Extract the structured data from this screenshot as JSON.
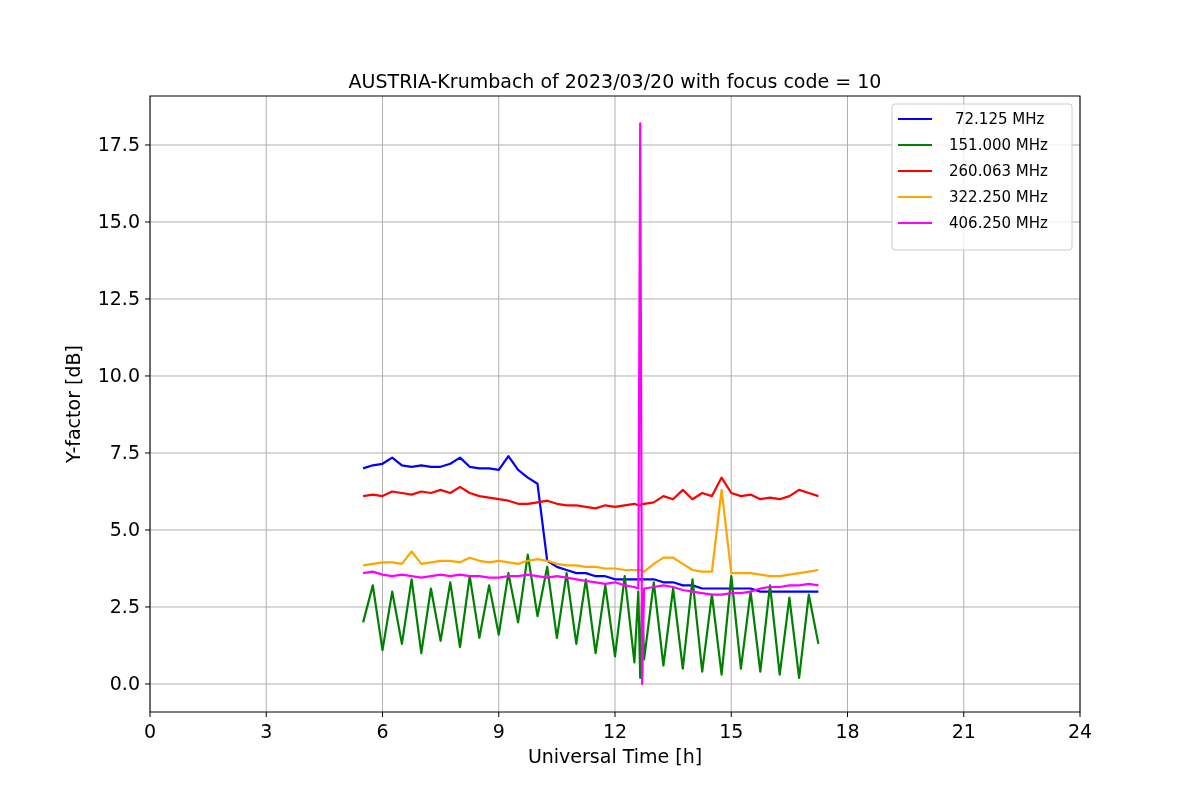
{
  "figure": {
    "chart_data": {
      "type": "line",
      "title": "AUSTRIA-Krumbach of 2023/03/20 with focus code = 10",
      "xlabel": "Universal Time [h]",
      "ylabel": "Y-factor [dB]",
      "x": [
        5.5,
        5.75,
        6.0,
        6.25,
        6.5,
        6.75,
        7.0,
        7.25,
        7.5,
        7.75,
        8.0,
        8.25,
        8.5,
        8.75,
        9.0,
        9.25,
        9.5,
        9.75,
        10.0,
        10.25,
        10.5,
        10.75,
        11.0,
        11.25,
        11.5,
        11.75,
        12.0,
        12.25,
        12.5,
        12.6,
        12.65,
        12.7,
        12.75,
        13.0,
        13.25,
        13.5,
        13.75,
        14.0,
        14.25,
        14.5,
        14.75,
        15.0,
        15.25,
        15.5,
        15.75,
        16.0,
        16.25,
        16.5,
        16.75,
        17.0,
        17.25
      ],
      "series": [
        {
          "name": "72.125 MHz",
          "color": "#0000ff",
          "values": [
            7.0,
            7.1,
            7.15,
            7.35,
            7.1,
            7.05,
            7.1,
            7.05,
            7.05,
            7.15,
            7.35,
            7.05,
            7.0,
            7.0,
            6.95,
            7.4,
            6.95,
            6.7,
            6.5,
            4.0,
            3.8,
            3.7,
            3.6,
            3.6,
            3.5,
            3.5,
            3.4,
            3.4,
            3.4,
            3.4,
            3.4,
            3.4,
            3.4,
            3.4,
            3.3,
            3.3,
            3.2,
            3.2,
            3.1,
            3.1,
            3.1,
            3.1,
            3.1,
            3.1,
            3.0,
            3.0,
            3.0,
            3.0,
            3.0,
            3.0,
            3.0
          ]
        },
        {
          "name": "151.000 MHz",
          "color": "#008000",
          "values": [
            2.0,
            3.2,
            1.1,
            3.0,
            1.3,
            3.4,
            1.0,
            3.1,
            1.4,
            3.3,
            1.2,
            3.5,
            1.5,
            3.2,
            1.6,
            3.6,
            2.0,
            4.2,
            2.2,
            3.8,
            1.5,
            3.6,
            1.3,
            3.4,
            1.0,
            3.2,
            0.9,
            3.5,
            0.7,
            3.0,
            0.2,
            2.8,
            0.8,
            3.3,
            0.6,
            3.1,
            0.5,
            3.4,
            0.4,
            2.9,
            0.3,
            3.5,
            0.5,
            3.0,
            0.4,
            3.2,
            0.3,
            2.8,
            0.2,
            2.9,
            1.3
          ]
        },
        {
          "name": "260.063 MHz",
          "color": "#ff0000",
          "values": [
            6.1,
            6.15,
            6.1,
            6.25,
            6.2,
            6.15,
            6.25,
            6.2,
            6.3,
            6.2,
            6.4,
            6.2,
            6.1,
            6.05,
            6.0,
            5.95,
            5.85,
            5.85,
            5.9,
            5.95,
            5.85,
            5.8,
            5.8,
            5.75,
            5.7,
            5.8,
            5.75,
            5.8,
            5.85,
            5.8,
            5.8,
            5.85,
            5.85,
            5.9,
            6.1,
            6.0,
            6.3,
            6.0,
            6.2,
            6.1,
            6.7,
            6.2,
            6.1,
            6.15,
            6.0,
            6.05,
            6.0,
            6.1,
            6.3,
            6.2,
            6.1
          ]
        },
        {
          "name": "322.250 MHz",
          "color": "#ffa500",
          "values": [
            3.85,
            3.9,
            3.95,
            3.95,
            3.9,
            4.3,
            3.9,
            3.95,
            4.0,
            4.0,
            3.95,
            4.1,
            4.0,
            3.95,
            4.0,
            3.95,
            3.9,
            4.0,
            4.05,
            4.0,
            3.9,
            3.85,
            3.85,
            3.8,
            3.8,
            3.75,
            3.75,
            3.7,
            3.7,
            3.7,
            3.7,
            3.7,
            3.65,
            3.9,
            4.1,
            4.1,
            3.9,
            3.7,
            3.65,
            3.65,
            6.3,
            3.6,
            3.6,
            3.6,
            3.55,
            3.5,
            3.5,
            3.55,
            3.6,
            3.65,
            3.7
          ]
        },
        {
          "name": "406.250 MHz",
          "color": "#ff00ff",
          "values": [
            3.6,
            3.65,
            3.55,
            3.5,
            3.55,
            3.5,
            3.45,
            3.5,
            3.55,
            3.5,
            3.55,
            3.5,
            3.5,
            3.45,
            3.45,
            3.5,
            3.5,
            3.55,
            3.5,
            3.45,
            3.5,
            3.45,
            3.4,
            3.35,
            3.3,
            3.25,
            3.3,
            3.2,
            3.15,
            3.1,
            18.2,
            0.0,
            3.1,
            3.15,
            3.2,
            3.15,
            3.05,
            3.0,
            2.95,
            2.9,
            2.9,
            2.95,
            2.95,
            3.0,
            3.1,
            3.15,
            3.15,
            3.2,
            3.2,
            3.25,
            3.2
          ]
        }
      ],
      "grid": true,
      "legend": true,
      "xlim": [
        0,
        24
      ],
      "ylim": [
        -0.91,
        19.09
      ],
      "xticks": [
        0,
        3,
        6,
        9,
        12,
        15,
        18,
        21,
        24
      ],
      "yticks": [
        {
          "value": 0,
          "label": "0.0"
        },
        {
          "value": 2.5,
          "label": "2.5"
        },
        {
          "value": 5,
          "label": "5.0"
        },
        {
          "value": 7.5,
          "label": "7.5"
        },
        {
          "value": 10,
          "label": "10.0"
        },
        {
          "value": 12.5,
          "label": "12.5"
        },
        {
          "value": 15,
          "label": "15.0"
        },
        {
          "value": 17.5,
          "label": "17.5"
        }
      ]
    }
  }
}
